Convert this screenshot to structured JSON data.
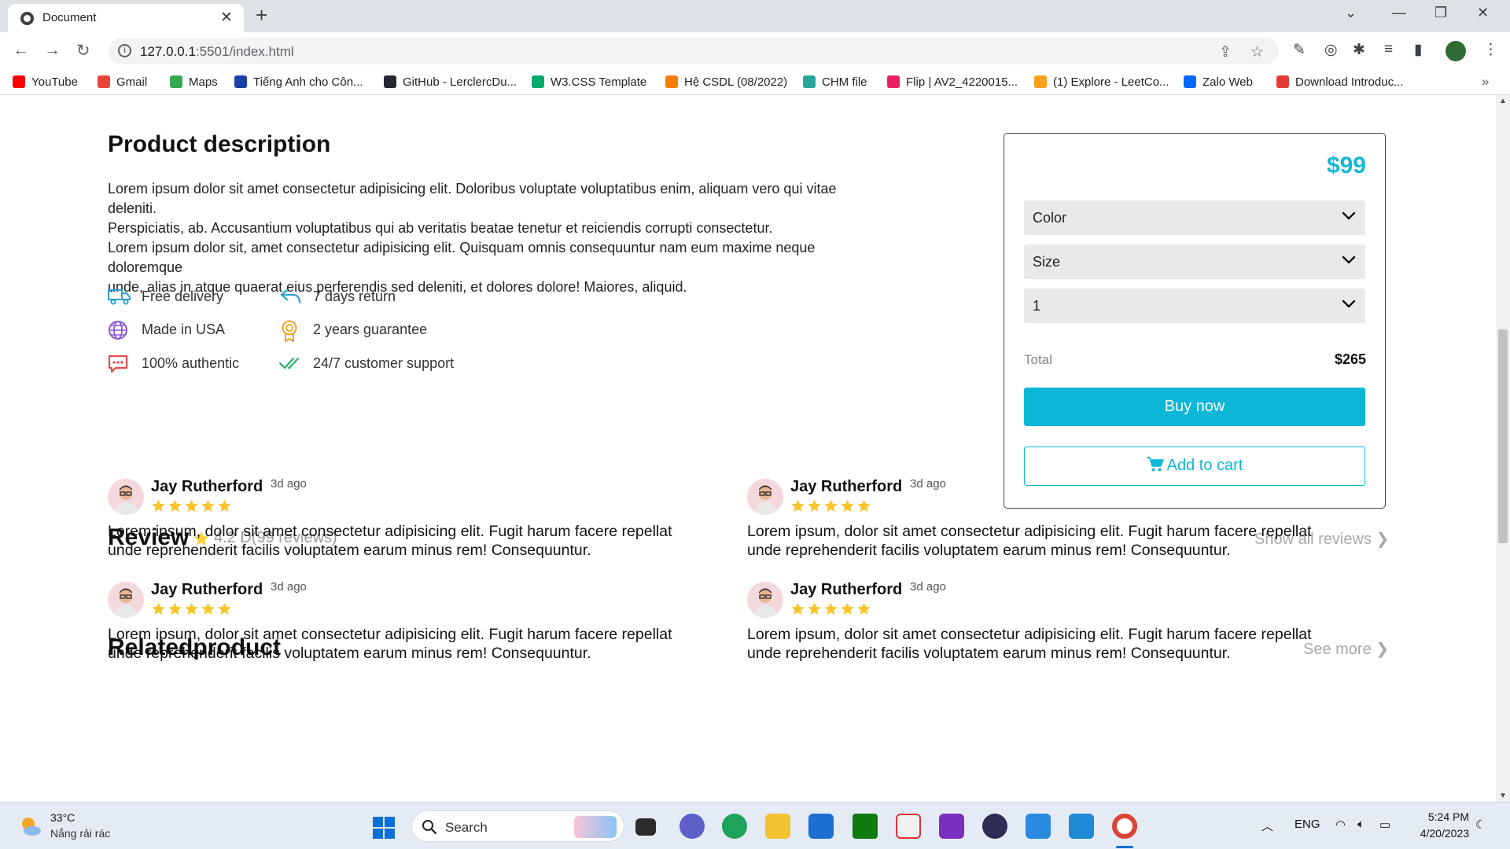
{
  "browser": {
    "tab_title": "Document",
    "url_host": "127.0.0.1",
    "url_rest": ":5501/index.html",
    "bookmarks": [
      {
        "label": "YouTube",
        "color": "#ff0000"
      },
      {
        "label": "Gmail",
        "color": "#ea4335"
      },
      {
        "label": "Maps",
        "color": "#34a853"
      },
      {
        "label": "Tiếng Anh cho Côn...",
        "color": "#1a3fa6"
      },
      {
        "label": "GitHub - LerclercDu...",
        "color": "#24292f"
      },
      {
        "label": "W3.CSS Template",
        "color": "#04aa6d"
      },
      {
        "label": "Hệ CSDL (08/2022)",
        "color": "#f57c00"
      },
      {
        "label": "CHM file",
        "color": "#26a69a"
      },
      {
        "label": "Flip | AV2_4220015...",
        "color": "#e91e63"
      },
      {
        "label": "(1) Explore - LeetCo...",
        "color": "#f89f1b"
      },
      {
        "label": "Zalo Web",
        "color": "#0068ff"
      },
      {
        "label": "Download Introduc...",
        "color": "#e53935"
      }
    ]
  },
  "product": {
    "heading": "Product description",
    "description_lines": [
      "Lorem ipsum dolor sit amet consectetur adipisicing elit. Doloribus voluptate voluptatibus enim, aliquam vero qui vitae deleniti.",
      "Perspiciatis, ab. Accusantium voluptatibus qui ab veritatis beatae tenetur et reiciendis corrupti consectetur.",
      "Lorem ipsum dolor sit, amet consectetur adipisicing elit. Quisquam omnis consequuntur nam eum maxime neque doloremque",
      "unde, alias in atque quaerat eius perferendis sed deleniti, et dolores dolore! Maiores, aliquid."
    ],
    "features": [
      {
        "label": "Free delivery",
        "icon": "truck-icon",
        "color": "#2aa3d4"
      },
      {
        "label": "7 days return",
        "icon": "return-arrow-icon",
        "color": "#2aa3d4"
      },
      {
        "label": "Made in USA",
        "icon": "globe-icon",
        "color": "#8a56d6"
      },
      {
        "label": "2 years guarantee",
        "icon": "award-icon",
        "color": "#f0a028"
      },
      {
        "label": "100% authentic",
        "icon": "chat-dots-icon",
        "color": "#e64545"
      },
      {
        "label": "24/7 customer support",
        "icon": "double-check-icon",
        "color": "#26b36b"
      }
    ]
  },
  "buybox": {
    "price": "$99",
    "selects": [
      "Color",
      "Size",
      "1"
    ],
    "total_label": "Total",
    "total_value": "$265",
    "buy_label": "Buy now",
    "cart_label": "Add to cart",
    "accent": "#0cb6d7"
  },
  "review_section": {
    "heading": "Review",
    "rating_summary": "4.2 D(99 reviews)",
    "show_all": "Show all reviews",
    "reviews": [
      {
        "name": "Jay Rutherford",
        "time": "3d ago",
        "stars": 5,
        "text_lines": [
          "Lorem ipsum, dolor sit amet consectetur adipisicing elit. Fugit harum facere repellat",
          "unde reprehenderit facilis voluptatem earum minus rem! Consequuntur."
        ]
      },
      {
        "name": "Jay Rutherford",
        "time": "3d ago",
        "stars": 5,
        "text_lines": [
          "Lorem ipsum, dolor sit amet consectetur adipisicing elit. Fugit harum facere repellat",
          "unde reprehenderit facilis voluptatem earum minus rem! Consequuntur."
        ]
      },
      {
        "name": "Jay Rutherford",
        "time": "3d ago",
        "stars": 5,
        "text_lines": [
          "Lorem ipsum, dolor sit amet consectetur adipisicing elit. Fugit harum facere repellat",
          "unde reprehenderit facilis voluptatem earum minus rem! Consequuntur."
        ]
      },
      {
        "name": "Jay Rutherford",
        "time": "3d ago",
        "stars": 5,
        "text_lines": [
          "Lorem ipsum, dolor sit amet consectetur adipisicing elit. Fugit harum facere repellat",
          "unde reprehenderit facilis voluptatem earum minus rem! Consequuntur."
        ]
      }
    ]
  },
  "related": {
    "heading": "Relatedproduct",
    "see_more": "See more"
  },
  "taskbar": {
    "temperature": "33°C",
    "weather": "Nắng rải rác",
    "search_label": "Search",
    "language": "ENG",
    "time": "5:24 PM",
    "date": "4/20/2023"
  }
}
